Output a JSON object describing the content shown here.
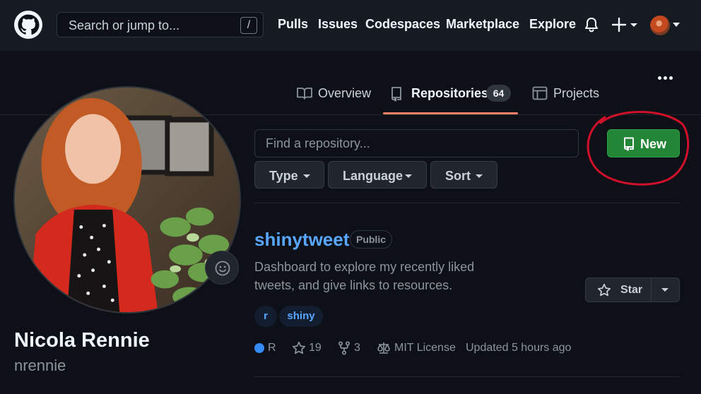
{
  "header": {
    "search_placeholder": "Search or jump to...",
    "search_shortcut": "/",
    "nav": [
      "Pulls",
      "Issues",
      "Codespaces",
      "Marketplace",
      "Explore"
    ]
  },
  "tabs": {
    "overview": "Overview",
    "repositories": "Repositories",
    "repositories_count": "64",
    "projects": "Projects",
    "active": "Repositories"
  },
  "profile": {
    "full_name": "Nicola Rennie",
    "username": "nrennie"
  },
  "repo_filters": {
    "find_placeholder": "Find a repository...",
    "type_label": "Type",
    "language_label": "Language",
    "sort_label": "Sort",
    "new_label": "New"
  },
  "repo": {
    "name": "shinytweet",
    "visibility": "Public",
    "description": "Dashboard to explore my recently liked tweets, and give links to resources.",
    "topics": [
      "r",
      "shiny"
    ],
    "language": "R",
    "language_color": "#358af5",
    "stars": "19",
    "forks": "3",
    "license": "MIT License",
    "updated": "Updated 5 hours ago",
    "star_label": "Star"
  },
  "colors": {
    "accent_underline": "#f78166",
    "new_button": "#238636",
    "link": "#58a6ff",
    "annotation_circle": "#d1102a"
  }
}
